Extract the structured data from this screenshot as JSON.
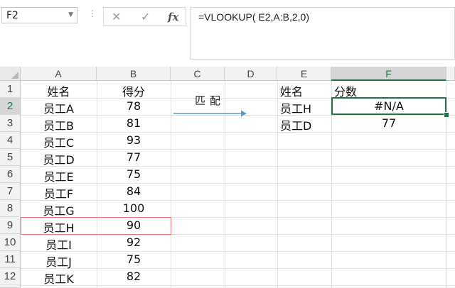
{
  "formula_bar": {
    "name_box": "F2",
    "cancel_glyph": "✕",
    "enter_glyph": "✓",
    "fx_glyph": "fx",
    "formula": "=VLOOKUP( E2,A:B,2,0)"
  },
  "columns": [
    "A",
    "B",
    "C",
    "D",
    "E",
    "F"
  ],
  "rows": [
    "1",
    "2",
    "3",
    "4",
    "5",
    "6",
    "7",
    "8",
    "9",
    "10",
    "11",
    "12"
  ],
  "sheet": {
    "A": [
      "姓名",
      "员工A",
      "员工B",
      "员工C",
      "员工D",
      "员工E",
      "员工F",
      "员工G",
      "员工H",
      "员工I",
      "员工J",
      "员工K"
    ],
    "B": [
      "得分",
      "78",
      "81",
      "93",
      "77",
      "75",
      "84",
      "100",
      "90",
      "92",
      "75",
      "82"
    ],
    "E": [
      "姓名",
      "员工H",
      "员工D"
    ],
    "F": [
      "分数",
      "#N/A",
      "77"
    ]
  },
  "annotation": {
    "label": "匹配"
  },
  "colors": {
    "accent": "#217346",
    "highlight_border": "#f07878",
    "arrow": "#5b9bd5"
  }
}
